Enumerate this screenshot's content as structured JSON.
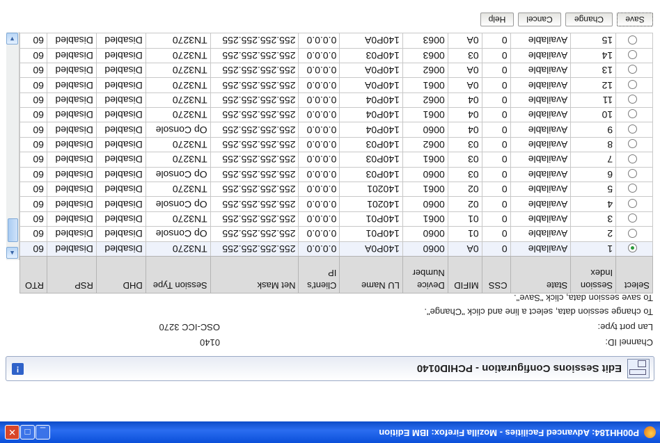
{
  "window": {
    "title": "P00HH184: Advanced Facilities - Mozilla Firefox: IBM Edition"
  },
  "panel": {
    "title": "Edit Sessions Configuration - PCHID0140",
    "help_label": "!"
  },
  "info": {
    "channel_label": "Channel ID:",
    "channel_value": "0140",
    "lan_label": "Lan port type:",
    "lan_value": "OSC-ICC 3270",
    "instruction_change": "To change session data, select a line and click \"Change\".",
    "instruction_save": "To save session data, click \"Save\"."
  },
  "table": {
    "headers": [
      "Select",
      "Session Index",
      "State",
      "CSS",
      "MIFID",
      "Device Number",
      "LU Name",
      "Client's IP",
      "Net Mask",
      "Session Type",
      "DHD",
      "RSP",
      "RTO"
    ],
    "rows": [
      {
        "selected": true,
        "cells": [
          "1",
          "Available",
          "0",
          "0A",
          "0060",
          "140P0A",
          "0.0.0.0",
          "255.255.255.255",
          "TN3270",
          "Disabled",
          "Disabled",
          "60"
        ]
      },
      {
        "selected": false,
        "cells": [
          "2",
          "Available",
          "0",
          "01",
          "0060",
          "140P01",
          "0.0.0.0",
          "255.255.255.255",
          "Op Console",
          "Disabled",
          "Disabled",
          "60"
        ]
      },
      {
        "selected": false,
        "cells": [
          "3",
          "Available",
          "0",
          "01",
          "0061",
          "140P01",
          "0.0.0.0",
          "255.255.255.255",
          "TN3270",
          "Disabled",
          "Disabled",
          "60"
        ]
      },
      {
        "selected": false,
        "cells": [
          "4",
          "Available",
          "0",
          "02",
          "0060",
          "140201",
          "0.0.0.0",
          "255.255.255.255",
          "Op Console",
          "Disabled",
          "Disabled",
          "60"
        ]
      },
      {
        "selected": false,
        "cells": [
          "5",
          "Available",
          "0",
          "02",
          "0061",
          "140201",
          "0.0.0.0",
          "255.255.255.255",
          "TN3270",
          "Disabled",
          "Disabled",
          "60"
        ]
      },
      {
        "selected": false,
        "cells": [
          "6",
          "Available",
          "0",
          "03",
          "0060",
          "140P03",
          "0.0.0.0",
          "255.255.255.255",
          "Op Console",
          "Disabled",
          "Disabled",
          "60"
        ]
      },
      {
        "selected": false,
        "cells": [
          "7",
          "Available",
          "0",
          "03",
          "0061",
          "140P03",
          "0.0.0.0",
          "255.255.255.255",
          "TN3270",
          "Disabled",
          "Disabled",
          "60"
        ]
      },
      {
        "selected": false,
        "cells": [
          "8",
          "Available",
          "0",
          "03",
          "0062",
          "140P03",
          "0.0.0.0",
          "255.255.255.255",
          "TN3270",
          "Disabled",
          "Disabled",
          "60"
        ]
      },
      {
        "selected": false,
        "cells": [
          "9",
          "Available",
          "0",
          "04",
          "0060",
          "140P04",
          "0.0.0.0",
          "255.255.255.255",
          "Op Console",
          "Disabled",
          "Disabled",
          "60"
        ]
      },
      {
        "selected": false,
        "cells": [
          "10",
          "Available",
          "0",
          "04",
          "0061",
          "140P04",
          "0.0.0.0",
          "255.255.255.255",
          "TN3270",
          "Disabled",
          "Disabled",
          "60"
        ]
      },
      {
        "selected": false,
        "cells": [
          "11",
          "Available",
          "0",
          "04",
          "0062",
          "140P04",
          "0.0.0.0",
          "255.255.255.255",
          "TN3270",
          "Disabled",
          "Disabled",
          "60"
        ]
      },
      {
        "selected": false,
        "cells": [
          "12",
          "Available",
          "0",
          "0A",
          "0061",
          "140P0A",
          "0.0.0.0",
          "255.255.255.255",
          "TN3270",
          "Disabled",
          "Disabled",
          "60"
        ]
      },
      {
        "selected": false,
        "cells": [
          "13",
          "Available",
          "0",
          "0A",
          "0062",
          "140P0A",
          "0.0.0.0",
          "255.255.255.255",
          "TN3270",
          "Disabled",
          "Disabled",
          "60"
        ]
      },
      {
        "selected": false,
        "cells": [
          "14",
          "Available",
          "0",
          "03",
          "0063",
          "140P03",
          "0.0.0.0",
          "255.255.255.255",
          "TN3270",
          "Disabled",
          "Disabled",
          "60"
        ]
      },
      {
        "selected": false,
        "cells": [
          "15",
          "Available",
          "0",
          "0A",
          "0063",
          "140P0A",
          "0.0.0.0",
          "255.255.255.255",
          "TN3270",
          "Disabled",
          "Disabled",
          "60"
        ]
      }
    ]
  },
  "toolbar": {
    "save_label": "Save",
    "change_label": "Change",
    "cancel_label": "Cancel",
    "help_label": "Help"
  },
  "icons": {
    "minimize": "minimize-icon",
    "maximize": "maximize-icon",
    "close": "close-icon",
    "firefox": "firefox-icon",
    "panel": "sessions-panel-icon"
  },
  "colors": {
    "titlebar": "#2b6df0",
    "header_bg": "#dcdcdc",
    "selected_radio": "#2b9a3c"
  }
}
